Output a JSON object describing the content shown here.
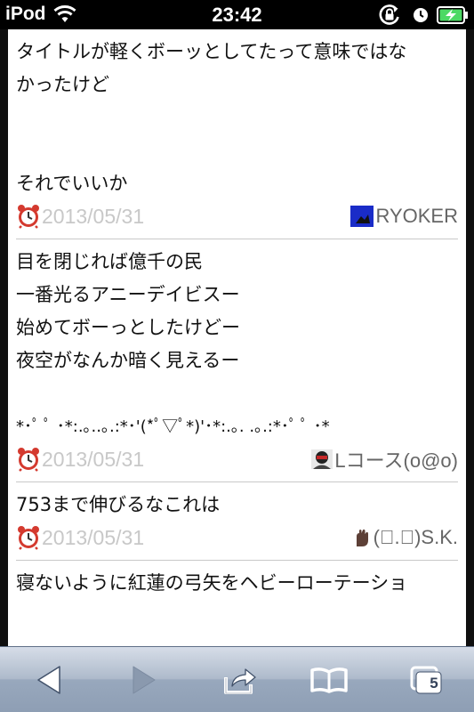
{
  "status_bar": {
    "carrier": "iPod",
    "time": "23:42"
  },
  "posts": [
    {
      "lines": [
        "タイトルが軽くボーッとしてたって意味ではな",
        "かったけど",
        "",
        "",
        "それでいいか"
      ],
      "date": "2013/05/31",
      "author": "RYOKER"
    },
    {
      "lines": [
        "目を閉じれば億千の民",
        "一番光るアニーデイビスー",
        "始めてボーっとしたけどー",
        "夜空がなんか暗く見えるー",
        "",
        "*･ﾟ ﾟ ･*:.｡..｡.:*･'(*ﾟ▽ﾟ*)'･*:.｡. .｡.:*･ﾟ ﾟ ･*"
      ],
      "date": "2013/05/31",
      "author": "Lコース(o@o)"
    },
    {
      "lines": [
        "753まで伸びるなこれは"
      ],
      "date": "2013/05/31",
      "author": "(ﾟ.ﾟ)S.K."
    },
    {
      "lines": [
        "寝ないように紅蓮の弓矢をヘビーローテーショ"
      ],
      "date": "",
      "author": ""
    }
  ],
  "toolbar": {
    "tab_count": "5"
  },
  "icons": {
    "status": [
      "wifi-icon",
      "orientation-lock-icon",
      "alarm-icon",
      "battery-charging-icon"
    ],
    "toolbar": [
      "back-arrow-icon",
      "forward-arrow-icon",
      "share-icon",
      "bookmarks-icon",
      "tabs-icon"
    ]
  },
  "colors": {
    "date_text": "#c8c8c8",
    "battery_charging": "#4cd964",
    "toolbar_gradient_top": "#d6dde8",
    "toolbar_gradient_bottom": "#8e9eb4"
  }
}
